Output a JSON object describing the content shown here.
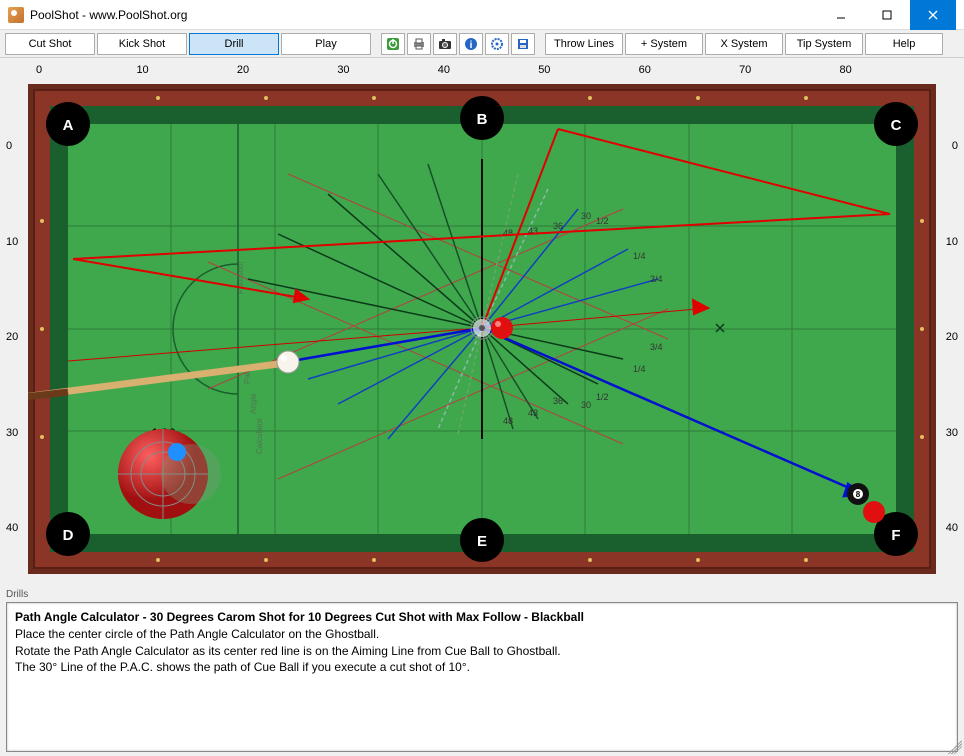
{
  "window": {
    "title": "PoolShot - www.PoolShot.org"
  },
  "toolbar": {
    "cut_shot": "Cut Shot",
    "kick_shot": "Kick Shot",
    "drill": "Drill",
    "play": "Play",
    "throw_lines": "Throw Lines",
    "plus_system": "+ System",
    "x_system": "X System",
    "tip_system": "Tip System",
    "help": "Help"
  },
  "ruler": {
    "top": [
      "0",
      "10",
      "20",
      "30",
      "40",
      "50",
      "60",
      "70",
      "80"
    ],
    "side": [
      "0",
      "10",
      "20",
      "30",
      "40"
    ]
  },
  "pockets": {
    "A": "A",
    "B": "B",
    "C": "C",
    "D": "D",
    "E": "E",
    "F": "F"
  },
  "cue_tip": {
    "angle_label": "10°"
  },
  "angle_labels": {
    "u30": "30",
    "u36": "36",
    "u43": "43",
    "u48": "48",
    "u12": "1/2",
    "u14": "1/4",
    "u34": "3/4",
    "l30": "30",
    "l36": "36",
    "l43": "43",
    "l48": "48",
    "l12": "1/2",
    "l14": "1/4",
    "l34": "3/4"
  },
  "pac_labels": {
    "poolshot": "PoolShot",
    "path": "Path",
    "angle": "Angle",
    "calculator": "Calculator"
  },
  "eight_ball": "8",
  "drills": {
    "panel_label": "Drills",
    "title": "Path Angle Calculator - 30 Degrees Carom Shot for 10 Degrees Cut Shot with Max Follow - Blackball",
    "line1": "Place the center circle of the Path Angle Calculator on the Ghostball.",
    "line2": "Rotate the Path Angle Calculator as its center red line is on the Aiming Line from Cue Ball to Ghostball.",
    "line3": "The 30° Line of the P.A.C. shows the path of Cue Ball if you execute a cut shot of 10°."
  }
}
